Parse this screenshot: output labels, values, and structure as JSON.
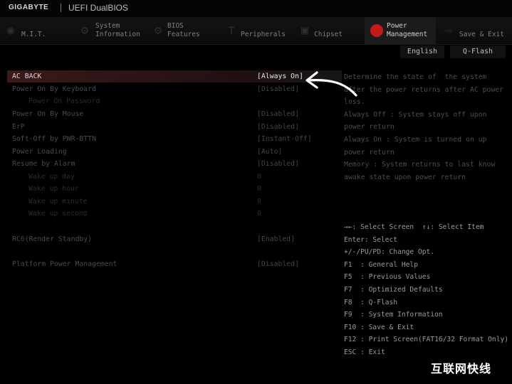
{
  "header": {
    "brand": "GIGABYTE",
    "product": "UEFI DualBIOS"
  },
  "tabs": [
    {
      "label": "M.I.T.",
      "icon": "mit-icon"
    },
    {
      "label": "System\nInformation",
      "icon": "gear-icon"
    },
    {
      "label": "BIOS\nFeatures",
      "icon": "gears-icon"
    },
    {
      "label": "Peripherals",
      "icon": "peripherals-icon"
    },
    {
      "label": "Chipset",
      "icon": "chipset-icon"
    },
    {
      "label": "Power\nManagement",
      "icon": "power-icon",
      "active": true
    },
    {
      "label": "Save & Exit",
      "icon": "exit-icon"
    }
  ],
  "subbar": {
    "language": "English",
    "qflash": "Q-Flash"
  },
  "settings": [
    {
      "name": "AC BACK",
      "value": "[Always On]",
      "selected": true
    },
    {
      "name": "Power On By Keyboard",
      "value": "[Disabled]"
    },
    {
      "name": "Power On Password",
      "value": "",
      "sub": true
    },
    {
      "name": "Power On By Mouse",
      "value": "[Disabled]"
    },
    {
      "name": "ErP",
      "value": "[Disabled]"
    },
    {
      "name": "Soft-Off by PWR-BTTN",
      "value": "[Instant-Off]"
    },
    {
      "name": "Power Loading",
      "value": "[Auto]"
    },
    {
      "name": "Resume by Alarm",
      "value": "[Disabled]"
    },
    {
      "name": "Wake up day",
      "value": "0",
      "sub": true
    },
    {
      "name": "Wake up hour",
      "value": "0",
      "sub": true
    },
    {
      "name": "Wake up minute",
      "value": "0",
      "sub": true
    },
    {
      "name": "Wake up second",
      "value": "0",
      "sub": true
    },
    {
      "name": "RC6(Render Standby)",
      "value": "[Enabled]"
    },
    {
      "name": "Platform Power Management",
      "value": "[Disabled]"
    }
  ],
  "help_lines": [
    "Determine the state of  the system",
    "after the power returns after AC power",
    "loss.",
    "Always Off : System stays off upon",
    "power return",
    "Always On : System is turned on up",
    "power return",
    "Memory : System returns to last know",
    "awake state upon power return"
  ],
  "key_lines": [
    "→←: Select Screen  ↑↓: Select Item",
    "Enter: Select",
    "+/-/PU/PD: Change Opt.",
    "F1  : General Help",
    "F5  : Previous Values",
    "F7  : Optimized Defaults",
    "F8  : Q-Flash",
    "F9  : System Information",
    "F10 : Save & Exit",
    "F12 : Print Screen(FAT16/32 Format Only)",
    "ESC : Exit"
  ],
  "watermark": "互联网快线",
  "colors": {
    "accent": "#c41a1a",
    "selected_row": "#3a1a1a"
  }
}
